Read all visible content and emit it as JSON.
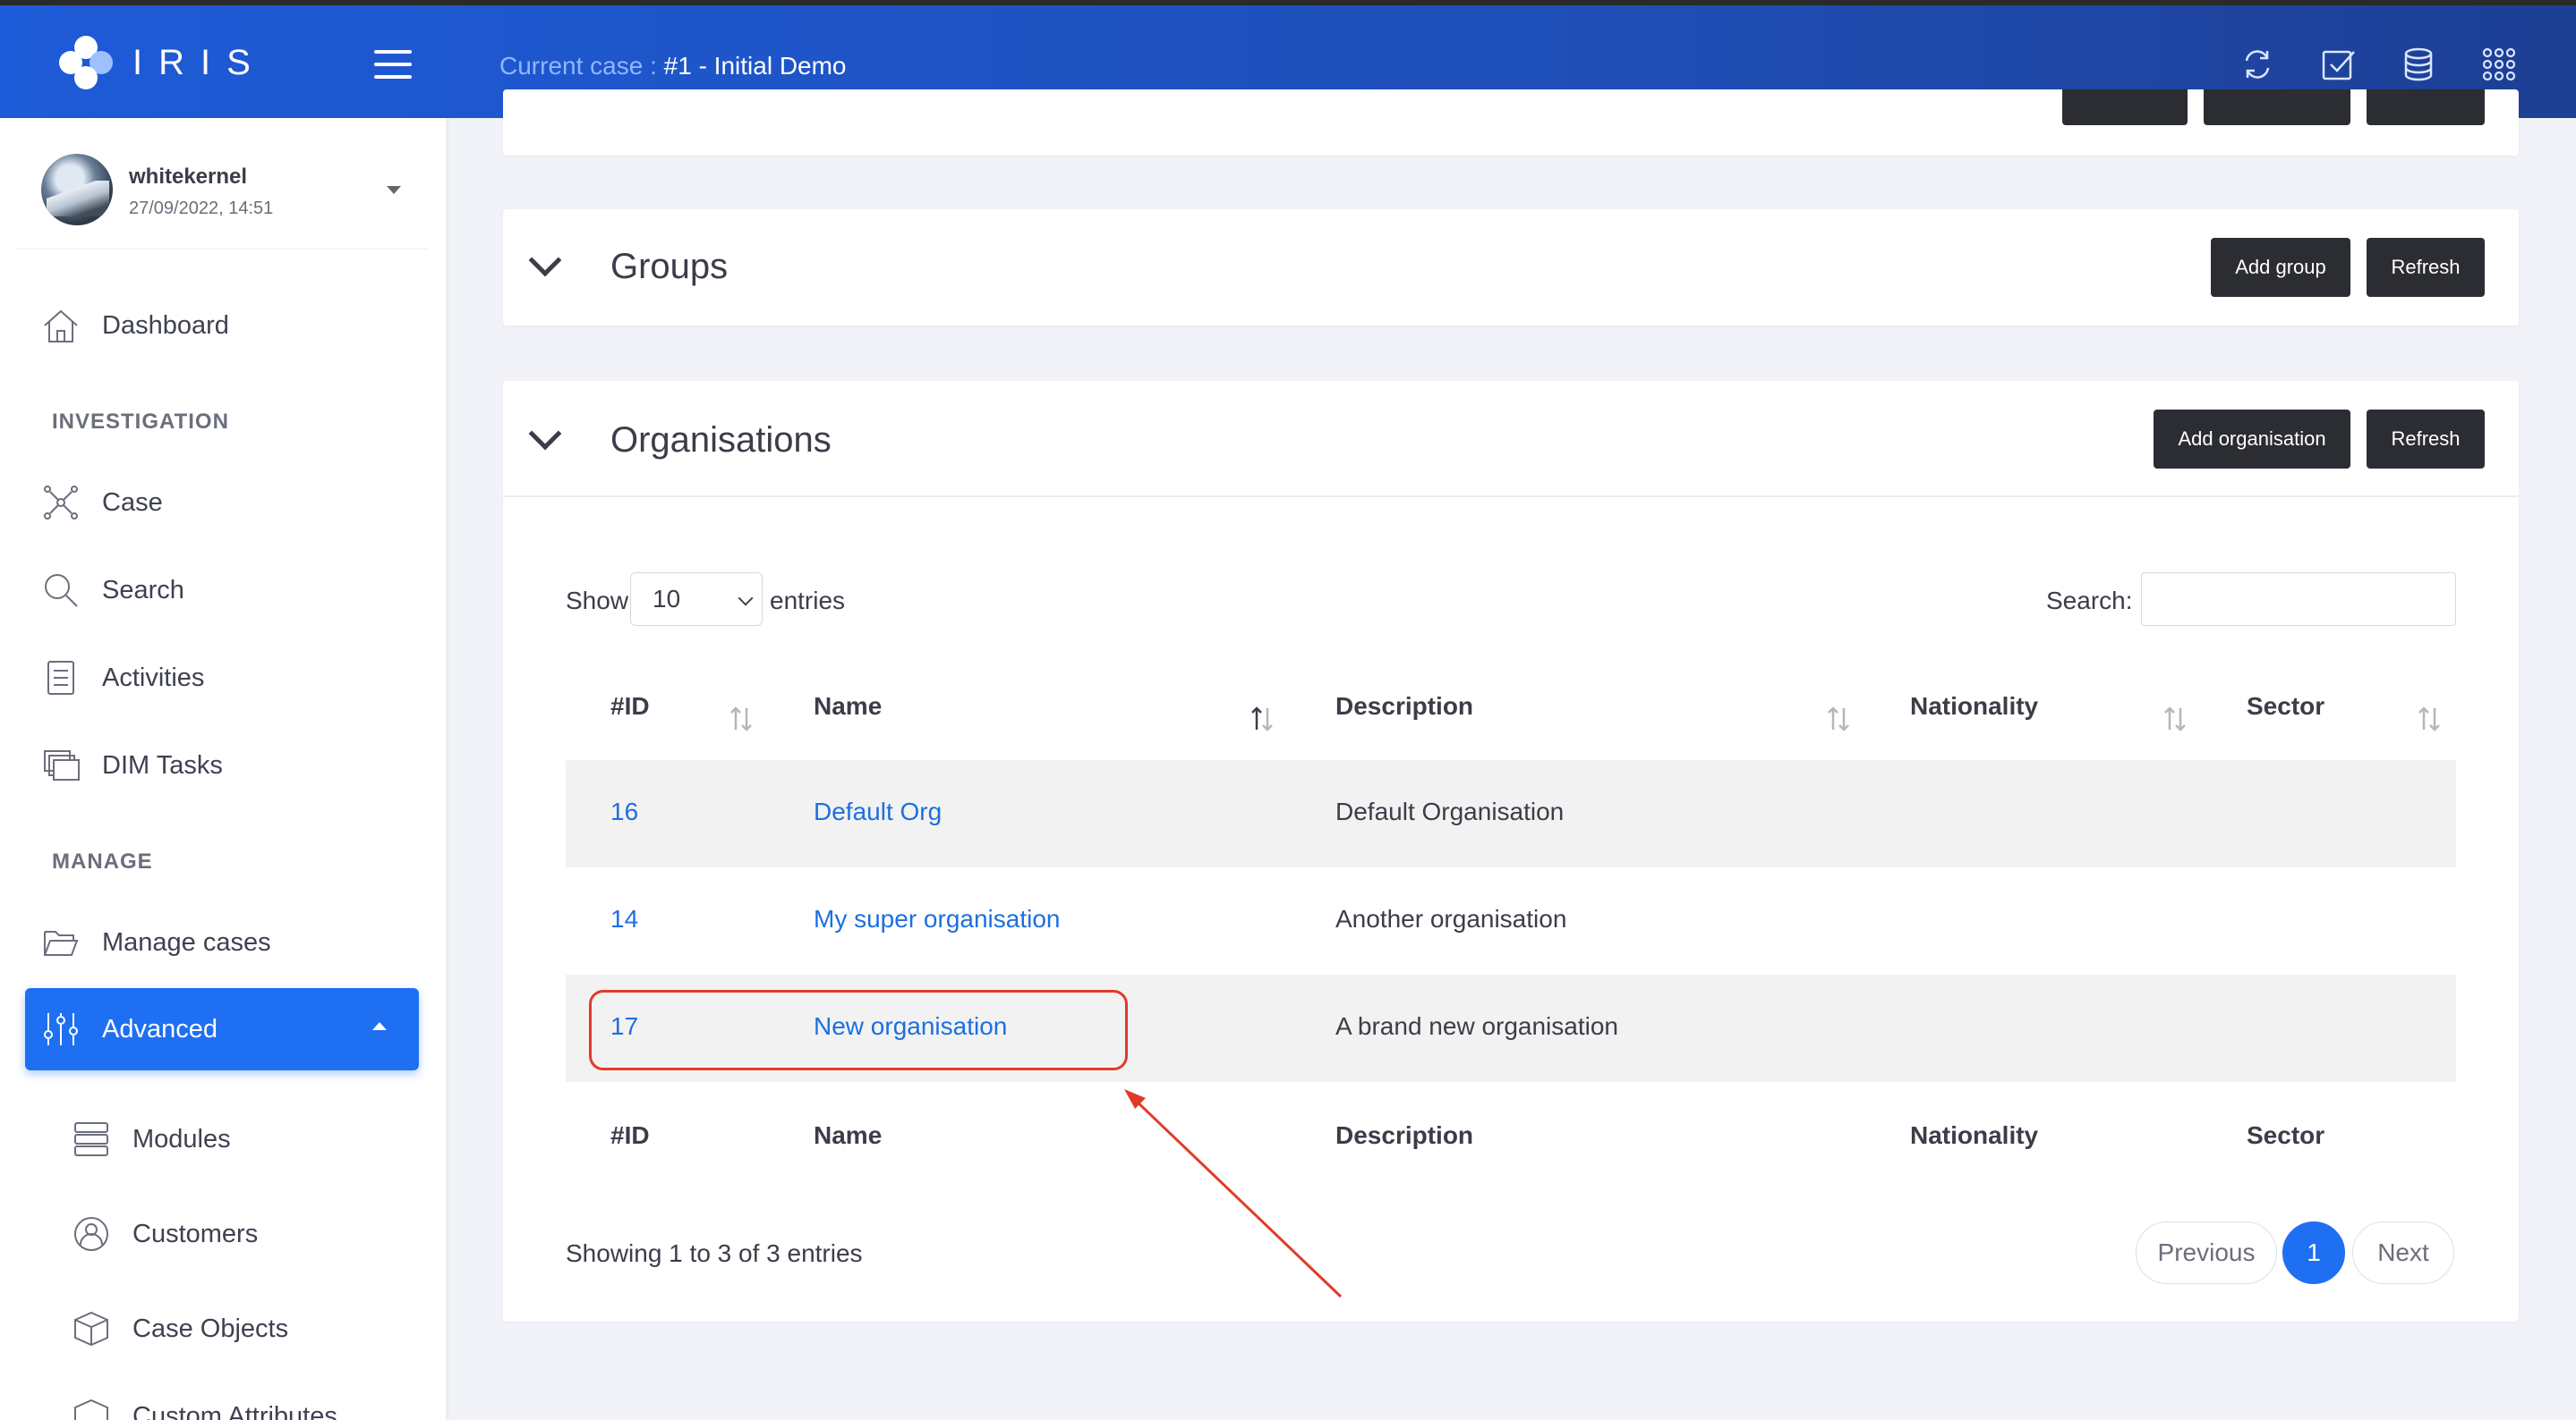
{
  "app": {
    "logo_text": "IRIS",
    "current_case_label": "Current case : ",
    "current_case_value": "#1 - Initial Demo",
    "top_icons": [
      "refresh-icon",
      "tasks-check-icon",
      "database-icon",
      "apps-grid-icon"
    ]
  },
  "user": {
    "name": "whitekernel",
    "date": "27/09/2022, 14:51"
  },
  "sidebar": {
    "dashboard": "Dashboard",
    "section_investigation": "INVESTIGATION",
    "case": "Case",
    "search": "Search",
    "activities": "Activities",
    "dim_tasks": "DIM Tasks",
    "section_manage": "MANAGE",
    "manage_cases": "Manage cases",
    "advanced": "Advanced",
    "modules": "Modules",
    "customers": "Customers",
    "case_objects": "Case Objects",
    "custom_attributes": "Custom Attributes"
  },
  "groups": {
    "title": "Groups",
    "add_label": "Add group",
    "refresh_label": "Refresh"
  },
  "organisations": {
    "title": "Organisations",
    "add_label": "Add organisation",
    "refresh_label": "Refresh",
    "show_label": "Show",
    "page_size": "10",
    "entries_label": "entries",
    "search_label": "Search:",
    "columns": [
      "#ID",
      "Name",
      "Description",
      "Nationality",
      "Sector"
    ],
    "rows": [
      {
        "id": "16",
        "name": "Default Org",
        "description": "Default Organisation",
        "nationality": "",
        "sector": ""
      },
      {
        "id": "14",
        "name": "My super organisation",
        "description": "Another organisation",
        "nationality": "",
        "sector": ""
      },
      {
        "id": "17",
        "name": "New organisation",
        "description": "A brand new organisation",
        "nationality": "",
        "sector": ""
      }
    ],
    "info": "Showing 1 to 3 of 3 entries",
    "pager": {
      "previous": "Previous",
      "current": "1",
      "next": "Next"
    }
  },
  "colors": {
    "accent": "#1f6ff2",
    "link": "#1d6fe0",
    "dark_button": "#2b2d33",
    "annotation": "#e23a2a"
  }
}
